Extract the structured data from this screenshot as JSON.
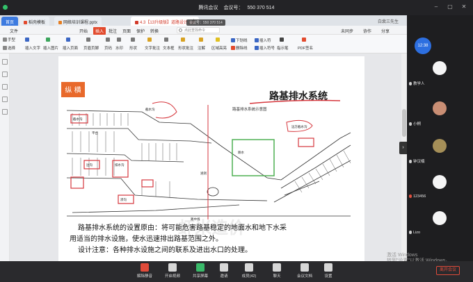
{
  "meeting": {
    "app_name": "腾讯会议",
    "meeting_id_label": "会议号：",
    "meeting_id": "550 370 514"
  },
  "tabs": {
    "home": "首页",
    "tab1": "稻壳模板",
    "tab2": "网络培训课程.pptx",
    "tab3": "4.3【13升级版】道路设计.pdf"
  },
  "tabbar_user": "白裴三先生",
  "share_badge": "会议号：550 370 514",
  "ribbon": {
    "items": [
      "文件",
      "开始",
      "插入",
      "批注",
      "页面",
      "保护",
      "转换"
    ],
    "active": "插入",
    "search_placeholder": "点此查找命令",
    "right_items": [
      "未同步",
      "协作",
      "分享"
    ]
  },
  "toolbar": {
    "row1": [
      "手型",
      "插入文字",
      "插入图片",
      "插入页面",
      "页眉页脚",
      "页码",
      "水印",
      "形状",
      "文字批注",
      "文本框",
      "形状批注",
      "注解",
      "区域高亮",
      "下划线",
      "删除线",
      "插入符",
      "插入符号",
      "指示笔",
      "PDF签名"
    ],
    "select_label": "选择"
  },
  "slide": {
    "brand": "纵 横",
    "title": "路基排水系统",
    "diagram_caption": "路基排水系统示意图",
    "label_catch_ditch": "截水沟",
    "label_side_ditch": "边沟",
    "label_drain_ditch": "排水沟",
    "label_culvert": "涵洞",
    "label_cutoff": "截水沟",
    "label_platform": "平台",
    "label_waterfall": "跌水",
    "label_far_ditch": "远方截水沟",
    "label_center": "路中线",
    "label_infiltration": "渗沟",
    "body_line1": "路基排水系统的设置原由：将可能危害路基稳定的地面水和地下水采",
    "body_line2": "用适当的排水设施，使水迅速排出路基范围之外。",
    "body_line3": "设计注意：各种排水设施之间的联系及进出水口的处理。",
    "watermark": "虾米造价"
  },
  "participants": {
    "timer": "12:38",
    "people": [
      {
        "name": "教学人"
      },
      {
        "name": "小桐"
      },
      {
        "name": "钟汉楠"
      },
      {
        "name": "123456"
      },
      {
        "name": "Lizo"
      }
    ]
  },
  "controls": {
    "mute": "解除静音",
    "video": "开启视频",
    "share": "共享屏幕",
    "invite": "邀请",
    "members": "成员(42)",
    "chat": "聊天",
    "docs": "会议文档",
    "settings": "设置",
    "leave": "离开会议"
  },
  "os_watermark": {
    "line1": "激活 Windows",
    "line2": "转到\"设置\"以激活 Windows。"
  }
}
